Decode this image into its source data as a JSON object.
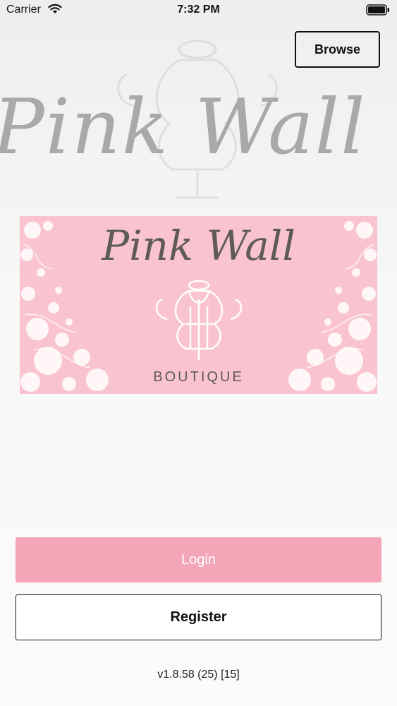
{
  "status_bar": {
    "carrier": "Carrier",
    "time": "7:32 PM",
    "icons": [
      "wifi-icon",
      "battery-icon"
    ]
  },
  "background": {
    "wordmark": "Pink Wall",
    "icon": "mannequin-icon"
  },
  "header": {
    "browse_label": "Browse"
  },
  "logo": {
    "wordmark": "Pink Wall",
    "subtitle": "BOUTIQUE",
    "icon": "mannequin-icon",
    "colors": {
      "background": "#f9c3cf",
      "text": "#5e5a59"
    }
  },
  "actions": {
    "login_label": "Login",
    "register_label": "Register"
  },
  "footer": {
    "version": "v1.8.58 (25) [15]"
  },
  "colors": {
    "accent": "#f4a5b8"
  }
}
